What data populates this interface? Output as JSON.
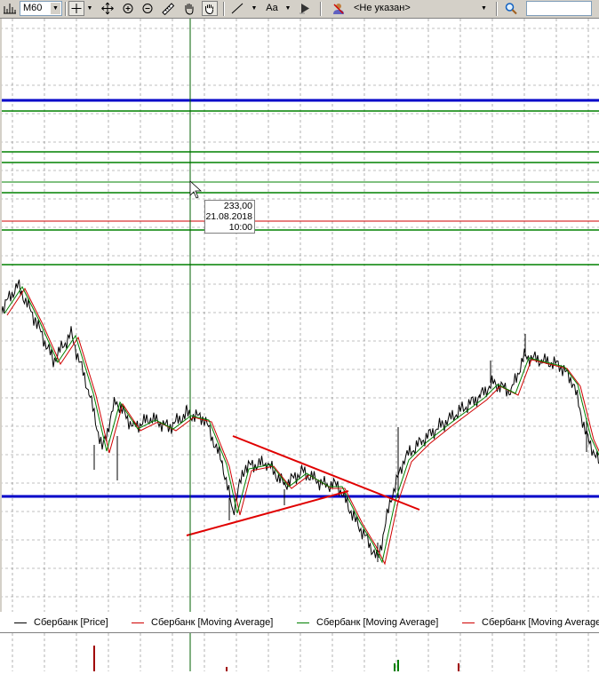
{
  "toolbar": {
    "timeframe": "M60",
    "instrument": "<Не указан>",
    "search_placeholder": "",
    "font_button": "Aa"
  },
  "crosshair_tooltip": {
    "price": "233,00",
    "date": "21.08.2018",
    "time": "10:00"
  },
  "legend": [
    {
      "label": "Сбербанк [Price]",
      "color": "#000000"
    },
    {
      "label": "Сбербанк [Moving Average]",
      "color": "#d00000"
    },
    {
      "label": "Сбербанк [Moving Average]",
      "color": "#008000"
    },
    {
      "label": "Сбербанк [Moving Average]",
      "color": "#d00000"
    }
  ],
  "colors": {
    "level_blue": "#0000c8",
    "level_green": "#008000",
    "level_red": "#d00000",
    "trendline": "#e00000",
    "grid": "#808080"
  }
}
